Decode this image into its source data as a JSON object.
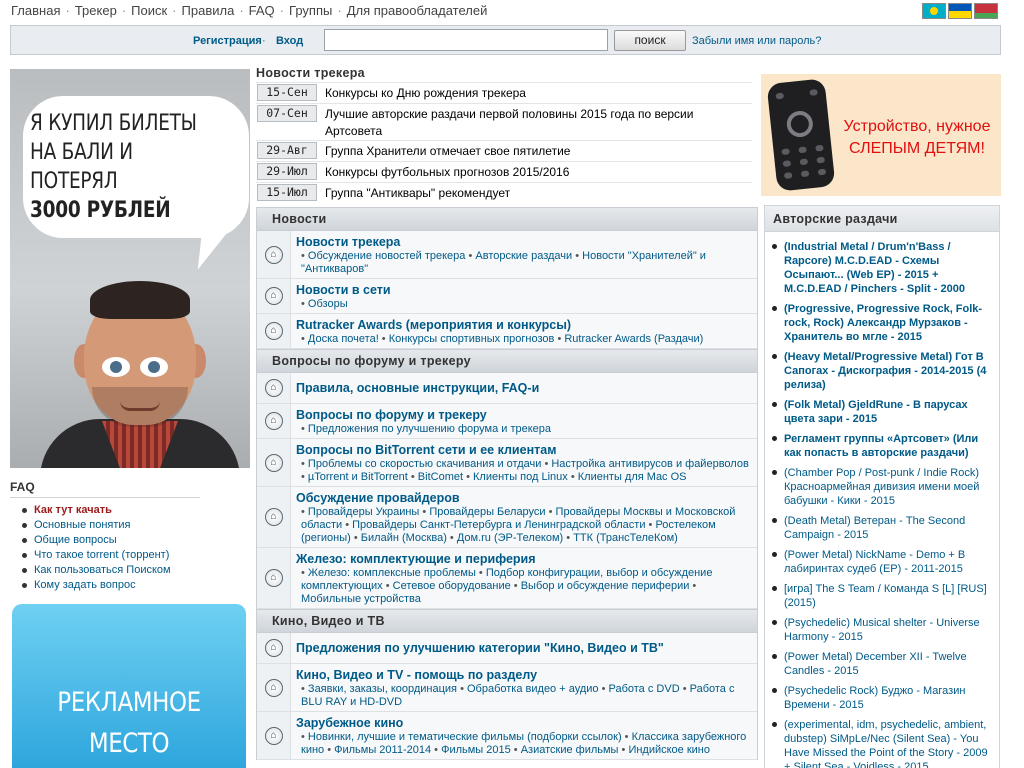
{
  "nav": {
    "items": [
      "Главная",
      "Трекер",
      "Поиск",
      "Правила",
      "FAQ",
      "Группы",
      "Для правообладателей"
    ]
  },
  "flags": [
    "kazakhstan-flag",
    "ukraine-flag",
    "belarus-flag"
  ],
  "login": {
    "register": "Регистрация",
    "separator": "·",
    "login": "Вход",
    "search_value": "",
    "search_button": "поиск",
    "forgot": "Забыли имя или пароль?"
  },
  "banner_left": {
    "line1": "Я КУПИЛ БИЛЕТЫ",
    "line2": "НА БАЛИ И ПОТЕРЯЛ",
    "line3": "3000 РУБЛЕЙ"
  },
  "faq": {
    "title": "FAQ",
    "items": [
      "Как тут качать",
      "Основные понятия",
      "Общие вопросы",
      "Что такое torrent (торрент)",
      "Как пользоваться Поиском",
      "Кому задать вопрос"
    ]
  },
  "banner_ad": {
    "line1": "РЕКЛАМНОЕ",
    "line2": "МЕСТО"
  },
  "news": {
    "title": "Новости трекера",
    "items": [
      {
        "date": "15-Сен",
        "text": "Конкурсы ко Дню рождения трекера"
      },
      {
        "date": "07-Сен",
        "text": "Лучшие авторские раздачи первой половины 2015 года по версии Артсовета"
      },
      {
        "date": "29-Авг",
        "text": "Группа Хранители отмечает свое пятилетие"
      },
      {
        "date": "29-Июл",
        "text": "Конкурсы футбольных прогнозов 2015/2016"
      },
      {
        "date": "15-Июл",
        "text": "Группа \"Антиквары\" рекомендует"
      }
    ]
  },
  "forum": {
    "categories": [
      {
        "title": "Новости",
        "forums": [
          {
            "name": "Новости трекера",
            "subs": [
              "Обсуждение новостей трекера",
              "Авторские раздачи",
              "Новости \"Хранителей\" и \"Антикваров\""
            ]
          },
          {
            "name": "Новости в сети",
            "subs": [
              "Обзоры"
            ]
          },
          {
            "name": "Rutracker Awards (мероприятия и конкурсы)",
            "subs": [
              "Доска почета!",
              "Конкурсы спортивных прогнозов",
              "Rutracker Awards (Раздачи)"
            ]
          }
        ]
      },
      {
        "title": "Вопросы по форуму и трекеру",
        "forums": [
          {
            "name": "Правила, основные инструкции, FAQ-и",
            "subs": []
          },
          {
            "name": "Вопросы по форуму и трекеру",
            "subs": [
              "Предложения по улучшению форума и трекера"
            ]
          },
          {
            "name": "Вопросы по BitTorrent сети и ее клиентам",
            "subs": [
              "Проблемы со скоростью скачивания и отдачи",
              "Настройка антивирусов и файерволов",
              "µTorrent и BitTorrent",
              "BitComet",
              "Клиенты под Linux",
              "Клиенты для Mac OS"
            ]
          },
          {
            "name": "Обсуждение провайдеров",
            "subs": [
              "Провайдеры Украины",
              "Провайдеры Беларуси",
              "Провайдеры Москвы и Московской области",
              "Провайдеры Санкт-Петербурга и Ленинградской области",
              "Ростелеком (регионы)",
              "Билайн (Москва)",
              "Дом.ru (ЭР-Телеком)",
              "ТТК (ТрансТелеКом)"
            ]
          },
          {
            "name": "Железо: комплектующие и периферия",
            "subs": [
              "Железо: комплексные проблемы",
              "Подбор конфигурации, выбор и обсуждение комплектующих",
              "Сетевое оборудование",
              "Выбор и обсуждение периферии",
              "Мобильные устройства"
            ]
          }
        ]
      },
      {
        "title": "Кино, Видео и ТВ",
        "forums": [
          {
            "name": "Предложения по улучшению категории \"Кино, Видео и ТВ\"",
            "subs": []
          },
          {
            "name": "Кино, Видео и TV - помощь по разделу",
            "subs": [
              "Заявки, заказы, координация",
              "Обработка видео + аудио",
              "Работа с DVD",
              "Работа с BLU RAY и HD-DVD"
            ]
          },
          {
            "name": "Зарубежное кино",
            "subs": [
              "Новинки, лучшие и тематические фильмы (подборки ссылок)",
              "Классика зарубежного кино",
              "Фильмы 2011-2014",
              "Фильмы 2015",
              "Азиатские фильмы",
              "Индийское кино"
            ]
          }
        ]
      }
    ]
  },
  "banner_right": {
    "line1": "Устройство, нужное",
    "line2": "СЛЕПЫМ ДЕТЯМ!"
  },
  "authors": {
    "title": "Авторские раздачи",
    "items": [
      {
        "text": "(Industrial Metal / Drum'n'Bass / Rapcore) M.C.D.EAD - Схемы Осыпают... (Web EP) - 2015 + M.C.D.EAD / Pinchers - Split - 2000",
        "bold": true
      },
      {
        "text": "(Progressive, Progressive Rock, Folk-rock, Rock) Александр Мурзаков - Хранитель во мгле - 2015",
        "bold": true
      },
      {
        "text": "(Heavy Metal/Progressive Metal) Гот В Сапогах - Дискография - 2014-2015 (4 релиза)",
        "bold": true
      },
      {
        "text": "(Folk Metal) GjeldRune - В парусах цвета зари - 2015",
        "bold": true
      },
      {
        "text": "Регламент группы «Артсовет» (Или как попасть в авторские раздачи)",
        "bold": true
      },
      {
        "text": "(Chamber Pop / Post-punk / Indie Rock) Красноармейная дивизия имени моей бабушки - Кики - 2015",
        "bold": false
      },
      {
        "text": "(Death Metal) Ветеран - The Second Campaign - 2015",
        "bold": false
      },
      {
        "text": "(Power Metal) NickName - Demo + В лабиринтах судеб (EP) - 2011-2015",
        "bold": false
      },
      {
        "text": "[игра] The S Team / Команда S [L] [RUS] (2015)",
        "bold": false
      },
      {
        "text": "(Psychedelic) Musical shelter - Universe Harmony - 2015",
        "bold": false
      },
      {
        "text": "(Power Metal) December XII - Twelve Candles - 2015",
        "bold": false
      },
      {
        "text": "(Psychedelic Rock) Буджо - Магазин Времени - 2015",
        "bold": false
      },
      {
        "text": "(experimental, idm, psychedelic, ambient, dubstep) SiMpLe/Nec (Silent Sea) - You Have Missed the Point of the Story - 2009 + Silent Sea - Voidless - 2015",
        "bold": false
      }
    ]
  }
}
